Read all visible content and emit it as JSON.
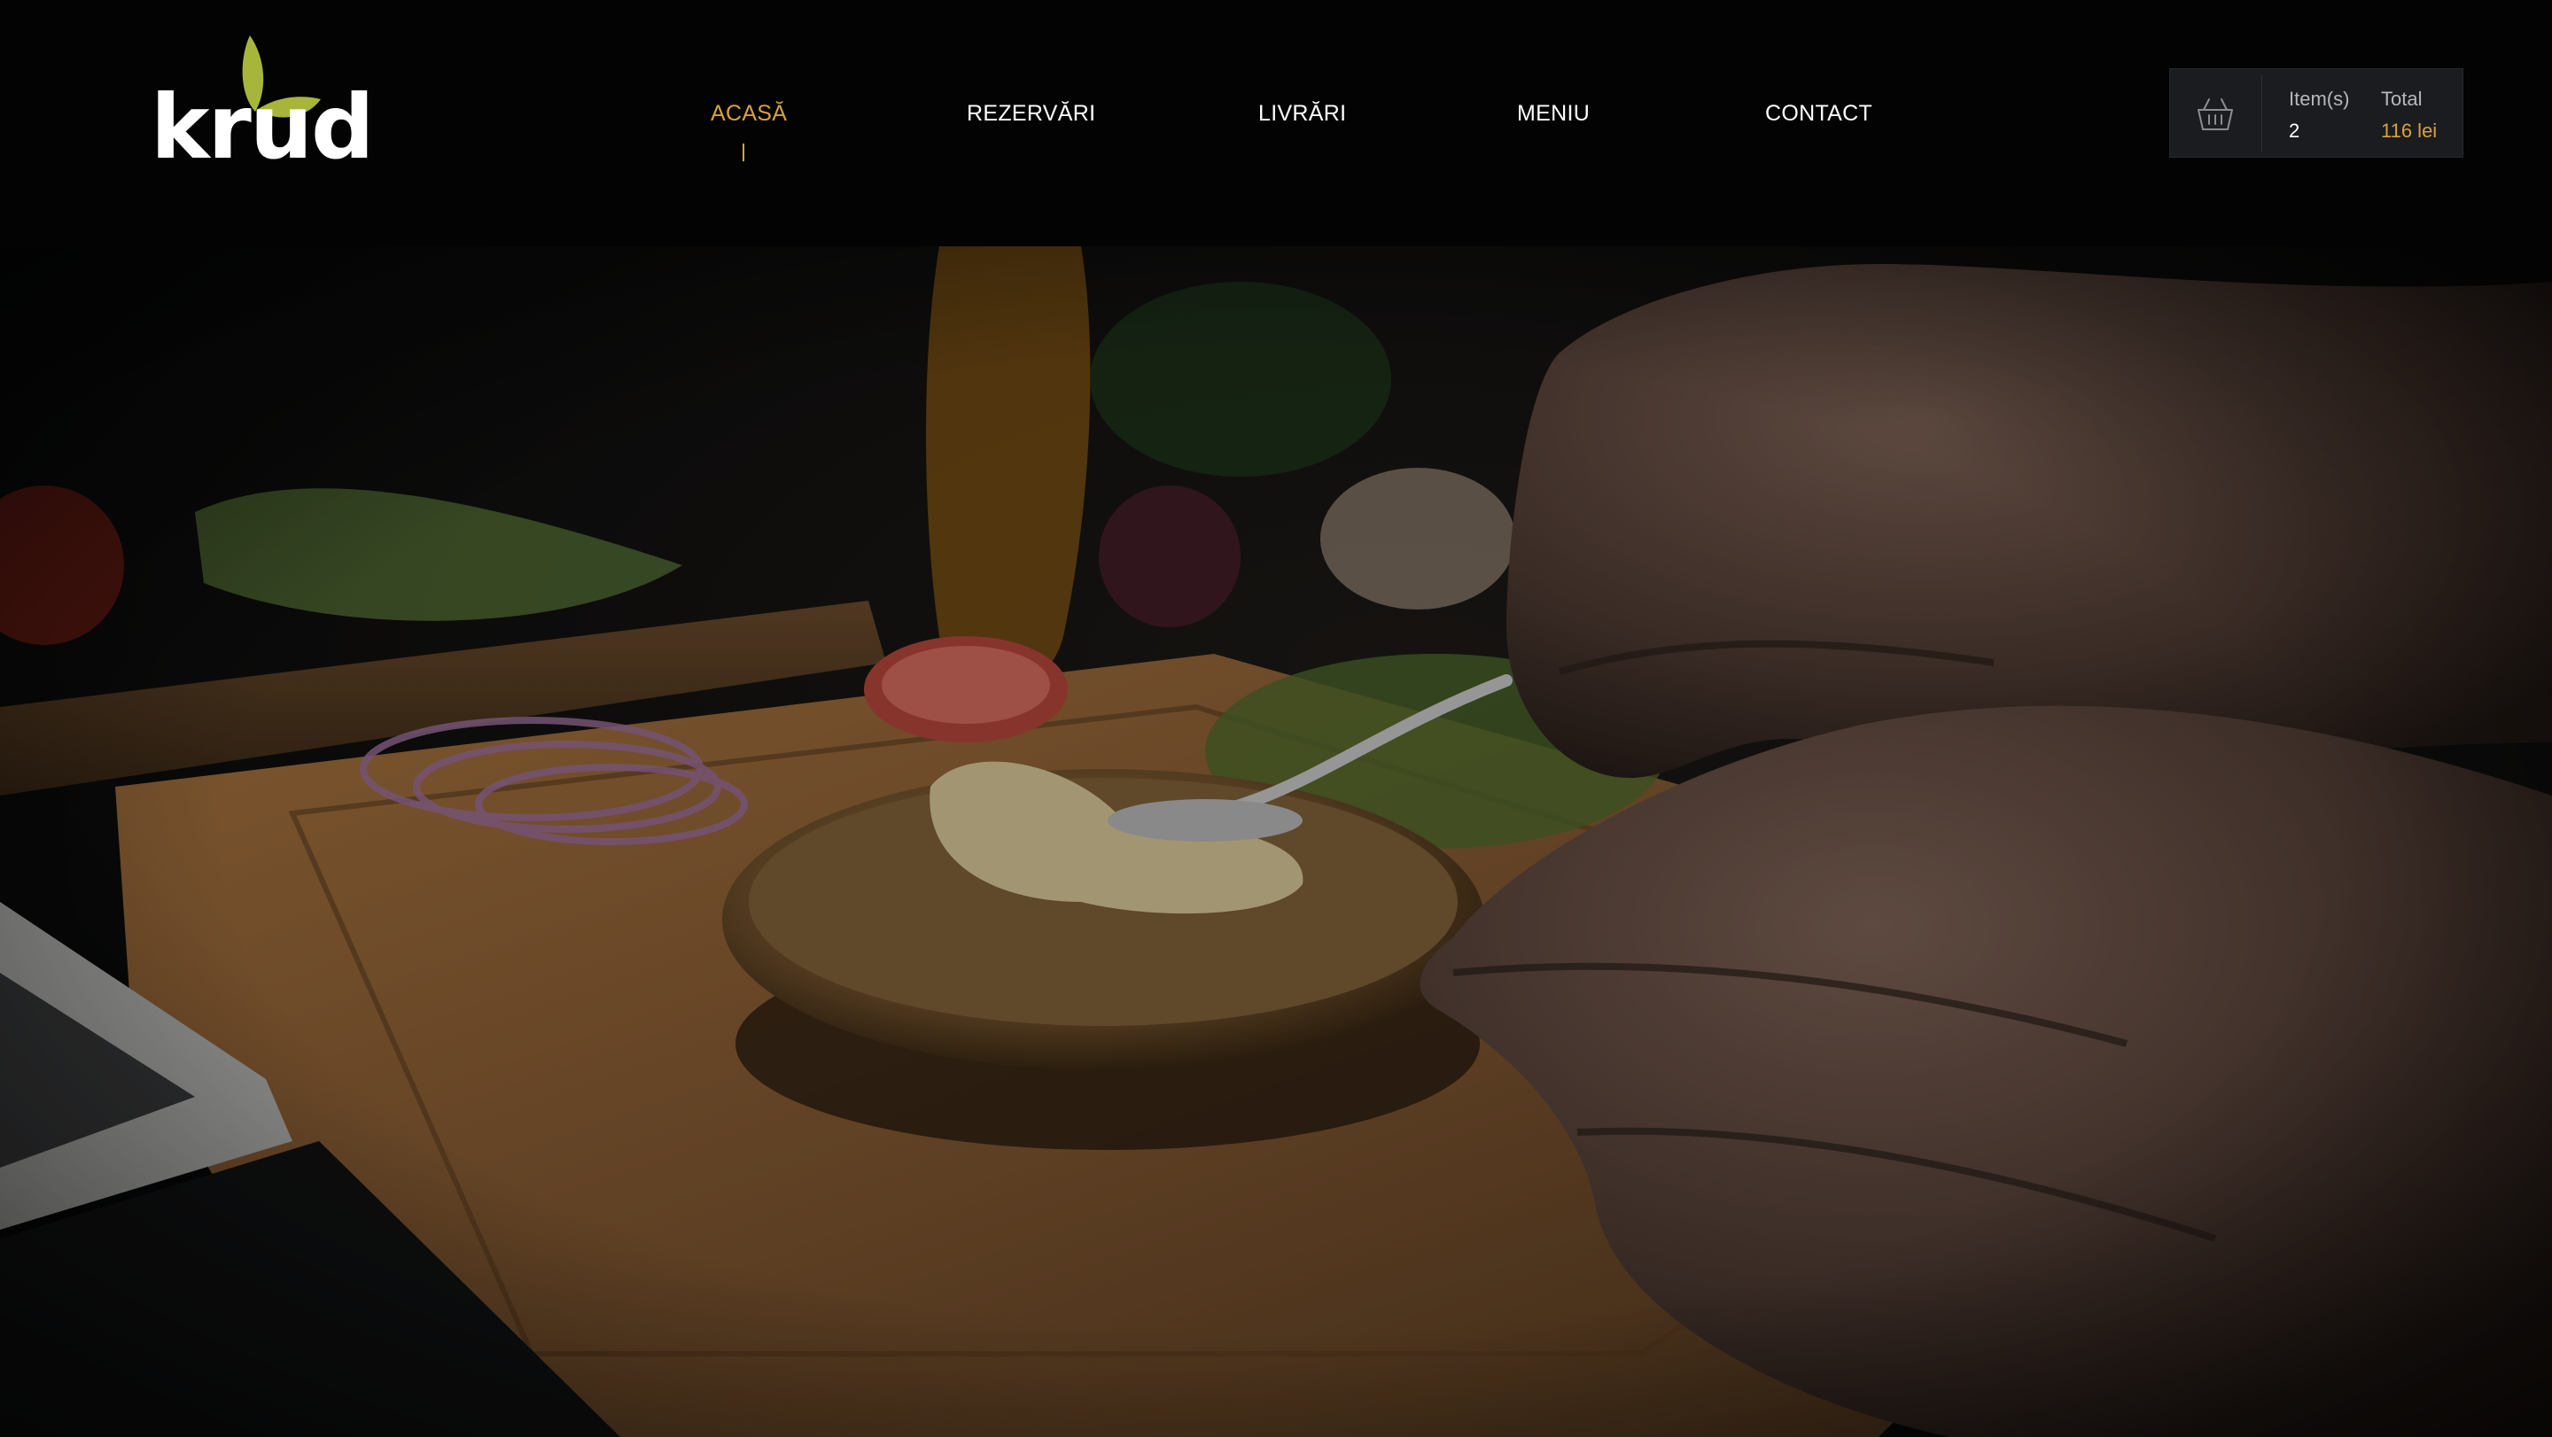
{
  "brand": {
    "name": "krud",
    "leaf_color": "#a7b63b"
  },
  "nav": {
    "items": [
      {
        "label": "ACASĂ",
        "active": true
      },
      {
        "label": "REZERVĂRI",
        "active": false
      },
      {
        "label": "LIVRĂRI",
        "active": false
      },
      {
        "label": "MENIU",
        "active": false
      },
      {
        "label": "CONTACT",
        "active": false
      }
    ],
    "active_color": "#d8a23e"
  },
  "cart": {
    "icon": "basket-icon",
    "items_label": "Item(s)",
    "items_count": "2",
    "total_label": "Total",
    "total_value": "116 lei"
  },
  "hero": {
    "media": "video-background",
    "description_icon": "burger-prep-scene"
  }
}
